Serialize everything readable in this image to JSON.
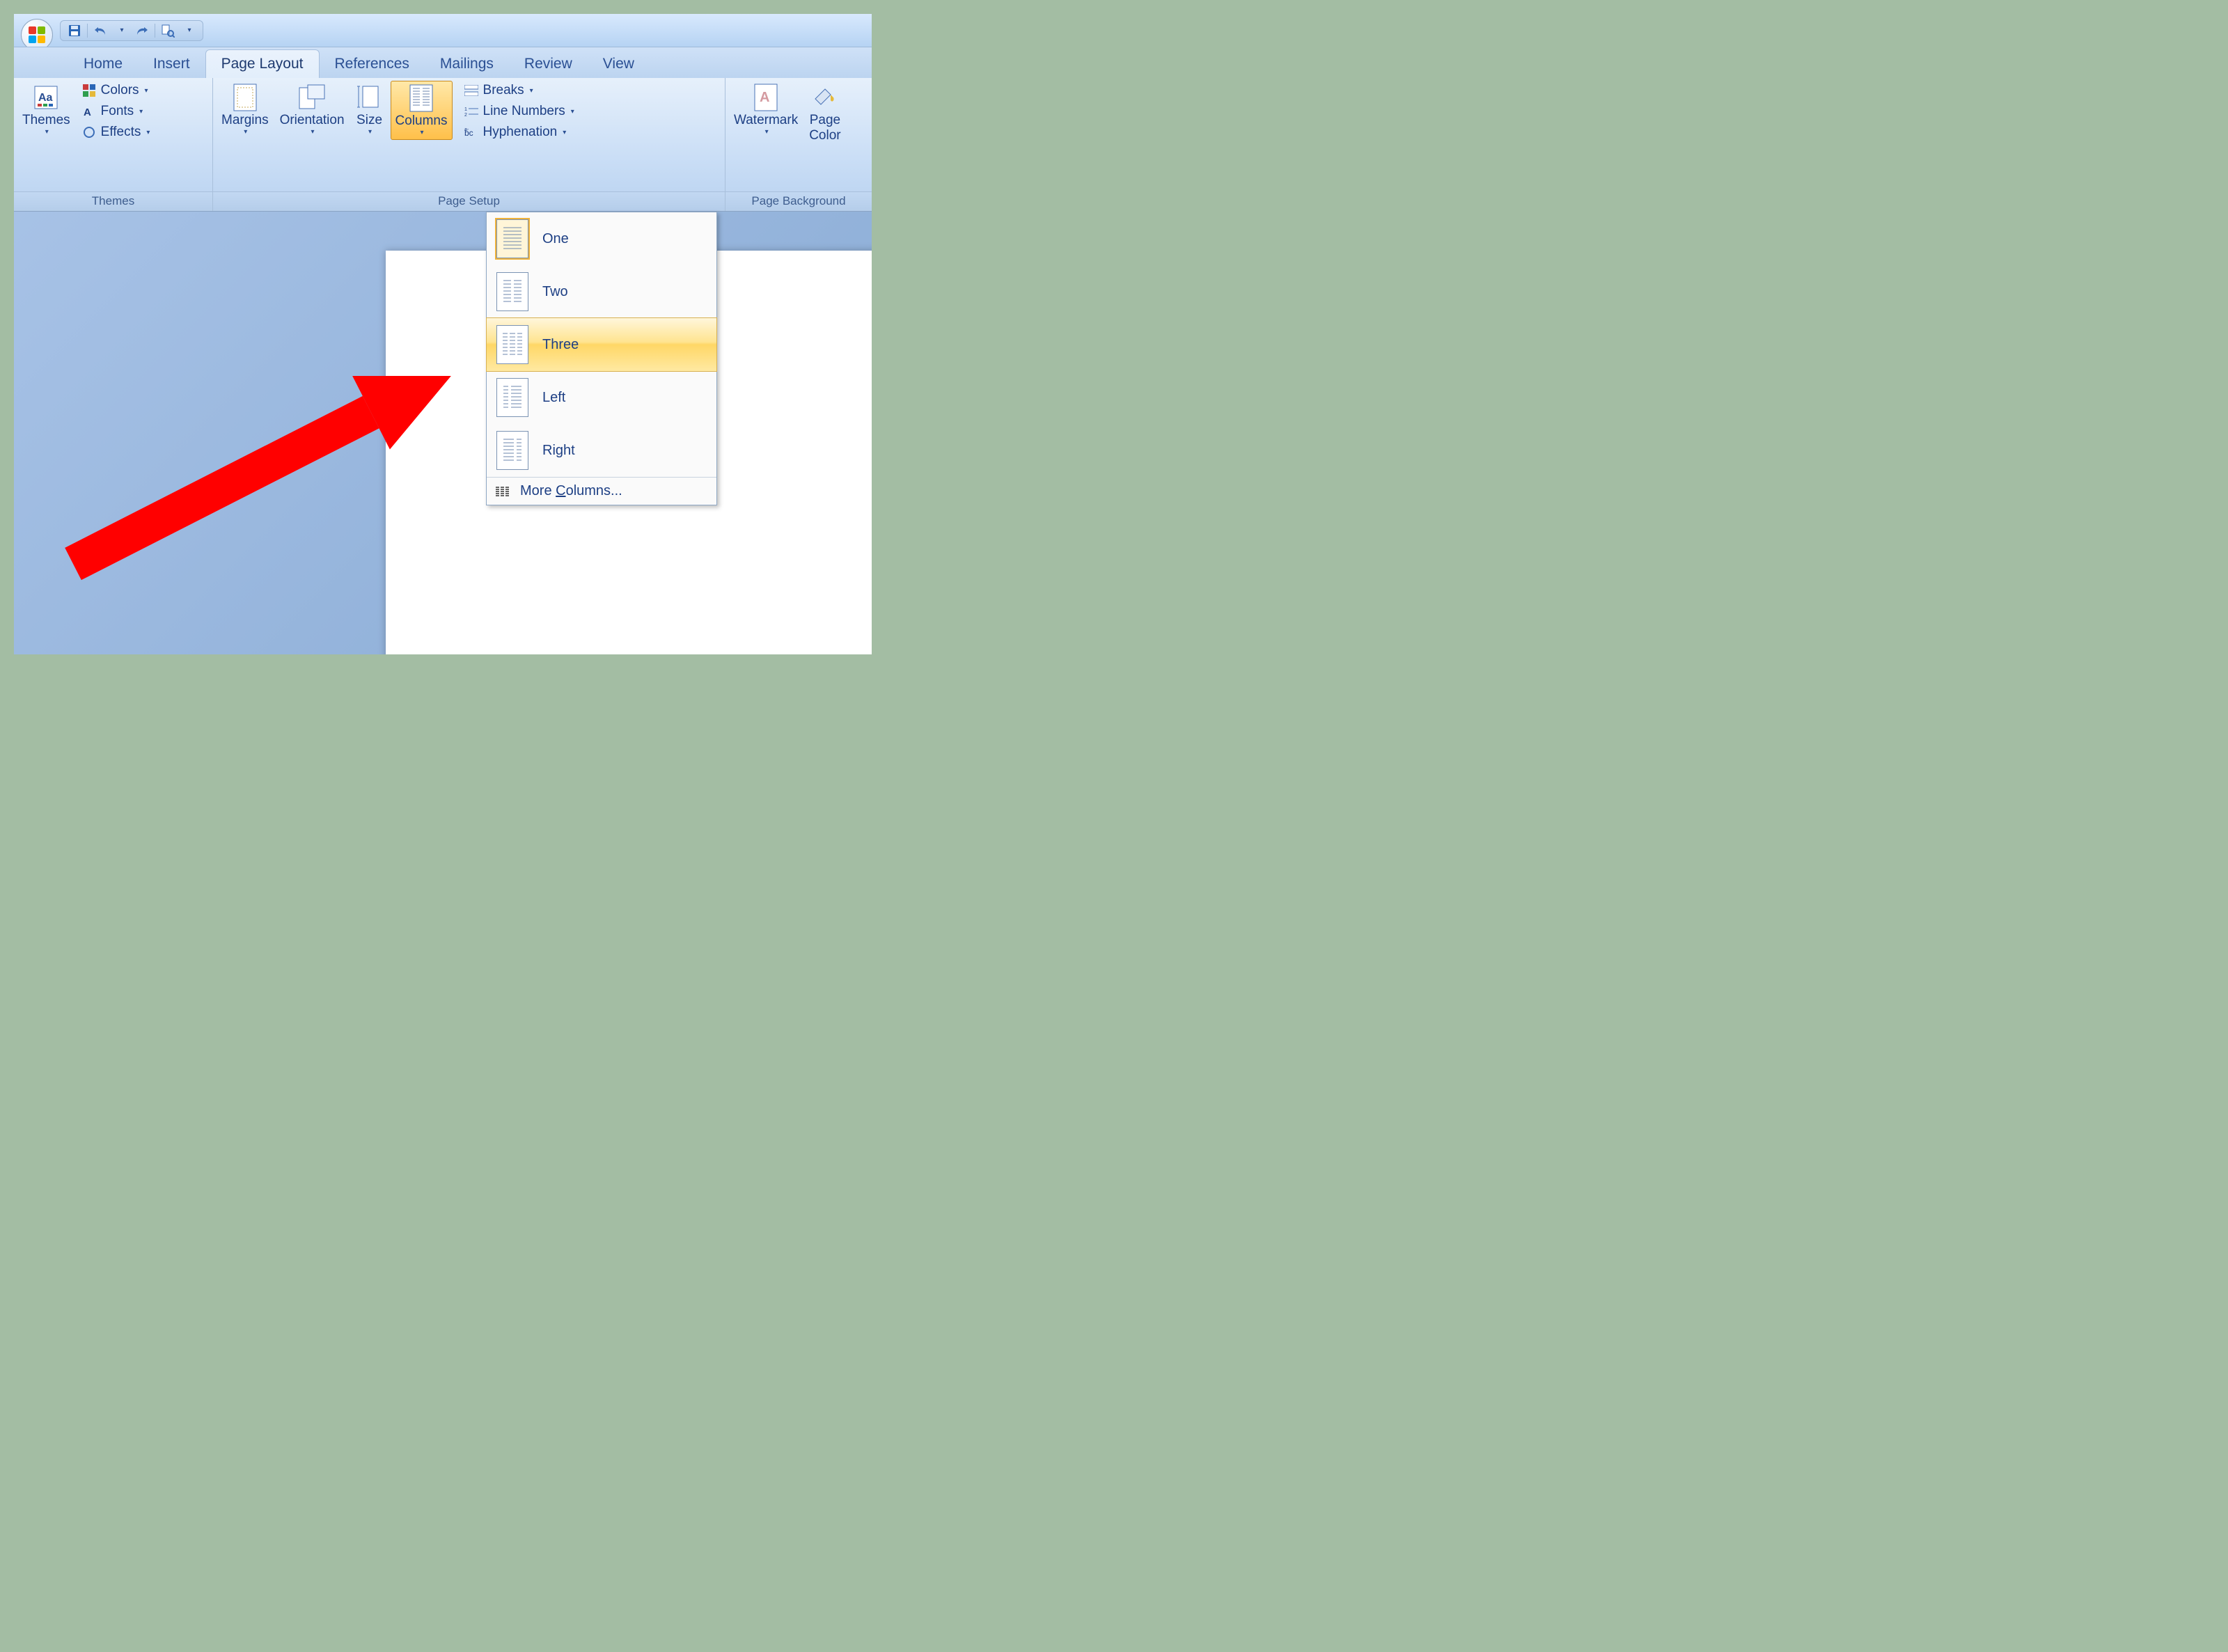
{
  "tabs": {
    "home": "Home",
    "insert": "Insert",
    "pagelayout": "Page Layout",
    "references": "References",
    "mailings": "Mailings",
    "review": "Review",
    "view": "View"
  },
  "groups": {
    "themes": "Themes",
    "pagesetup": "Page Setup",
    "pagebg": "Page Background"
  },
  "themesGroup": {
    "themes": "Themes",
    "colors": "Colors",
    "fonts": "Fonts",
    "effects": "Effects"
  },
  "pageSetup": {
    "margins": "Margins",
    "orientation": "Orientation",
    "size": "Size",
    "columns": "Columns",
    "breaks": "Breaks",
    "lineNumbers": "Line Numbers",
    "hyphenation": "Hyphenation"
  },
  "pageBg": {
    "watermark": "Watermark",
    "pageColor": "Page\nColor"
  },
  "columnsMenu": {
    "one": "One",
    "two": "Two",
    "three": "Three",
    "left": "Left",
    "right": "Right",
    "more": "More Columns..."
  }
}
